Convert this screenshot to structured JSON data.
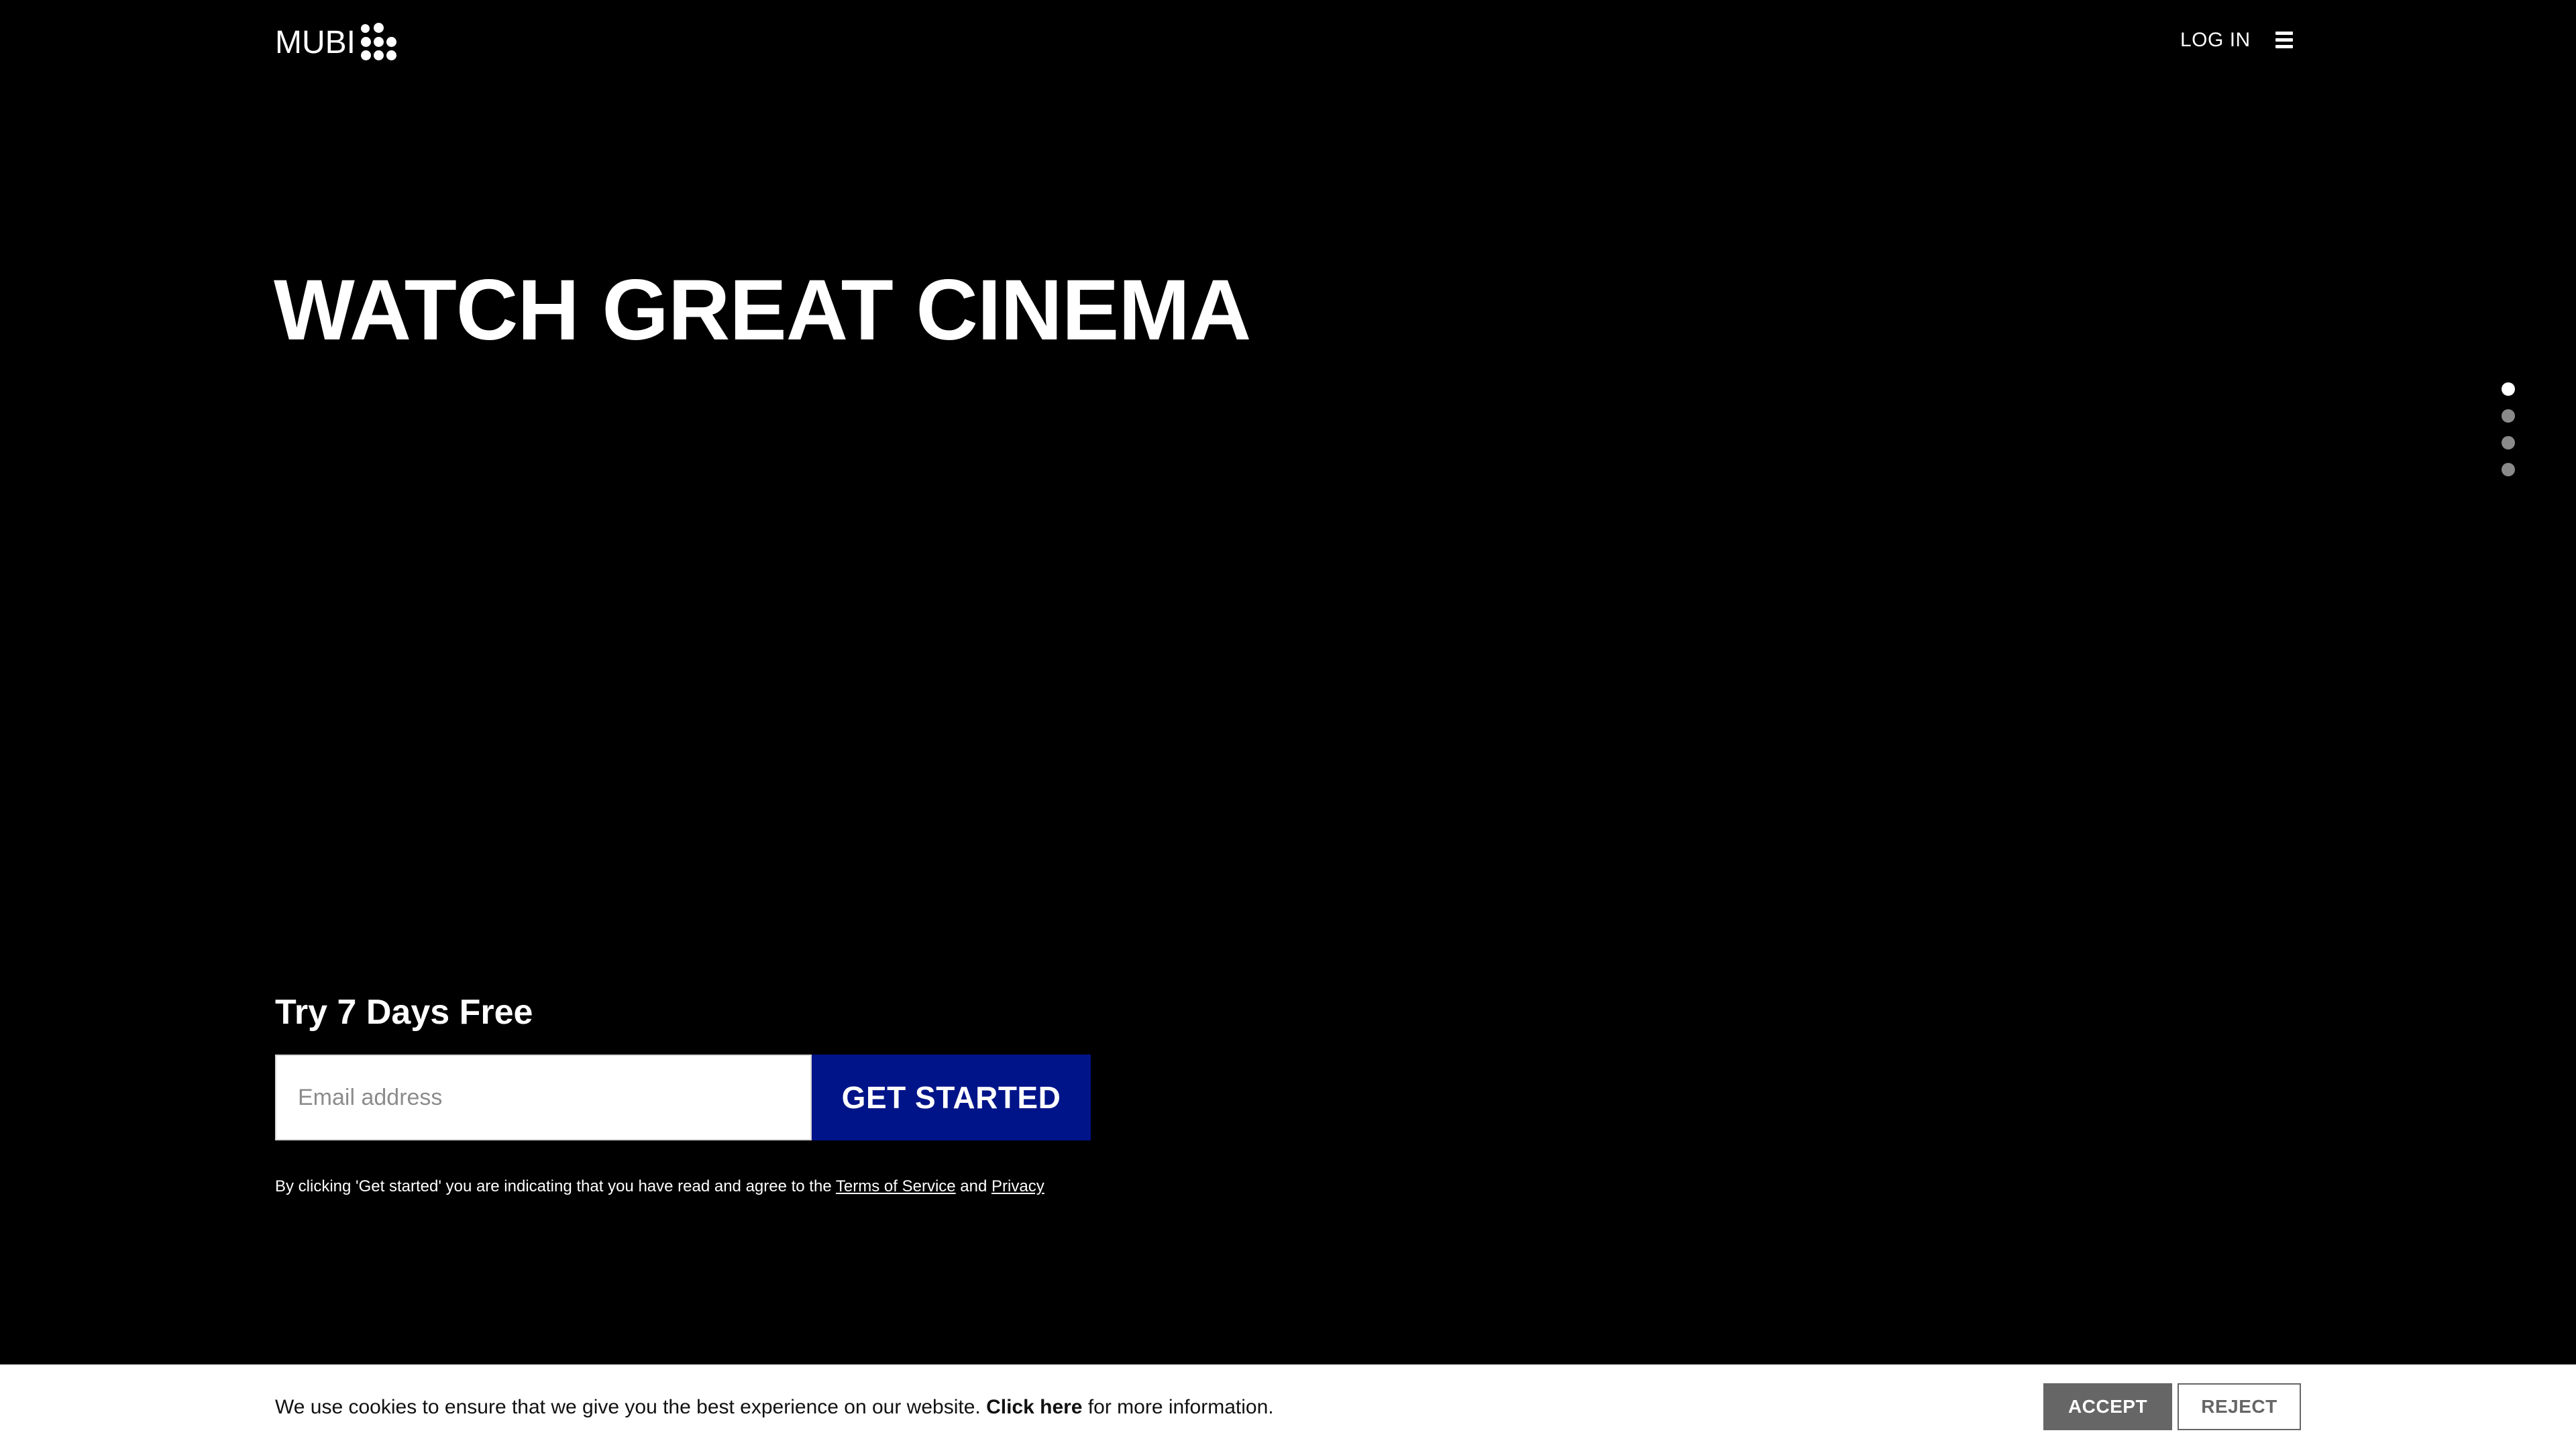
{
  "header": {
    "logo_text": "MUBI",
    "login_label": "LOG IN",
    "menu_icon": "hamburger-menu-icon"
  },
  "hero": {
    "title": "WATCH GREAT CINEMA",
    "slide_count": 4,
    "active_slide": 1
  },
  "signup": {
    "title": "Try 7 Days Free",
    "email_placeholder": "Email address",
    "email_value": "",
    "button_label": "GET STARTED",
    "button_color": "#001489",
    "legal_prefix": "By clicking 'Get started' you are indicating that you have read and agree to the ",
    "terms_label": "Terms of Service",
    "legal_and": " and ",
    "privacy_label": "Privacy"
  },
  "cookie_banner": {
    "text": "We use cookies to ensure that we give you the best experience on our website. ",
    "link_label": "Click here",
    "text_suffix": " for more information.",
    "accept_label": "ACCEPT",
    "reject_label": "REJECT"
  },
  "colors": {
    "background": "#000000",
    "cta_blue": "#001489",
    "cookie_bg": "#ffffff",
    "accept_bg": "#666666"
  }
}
